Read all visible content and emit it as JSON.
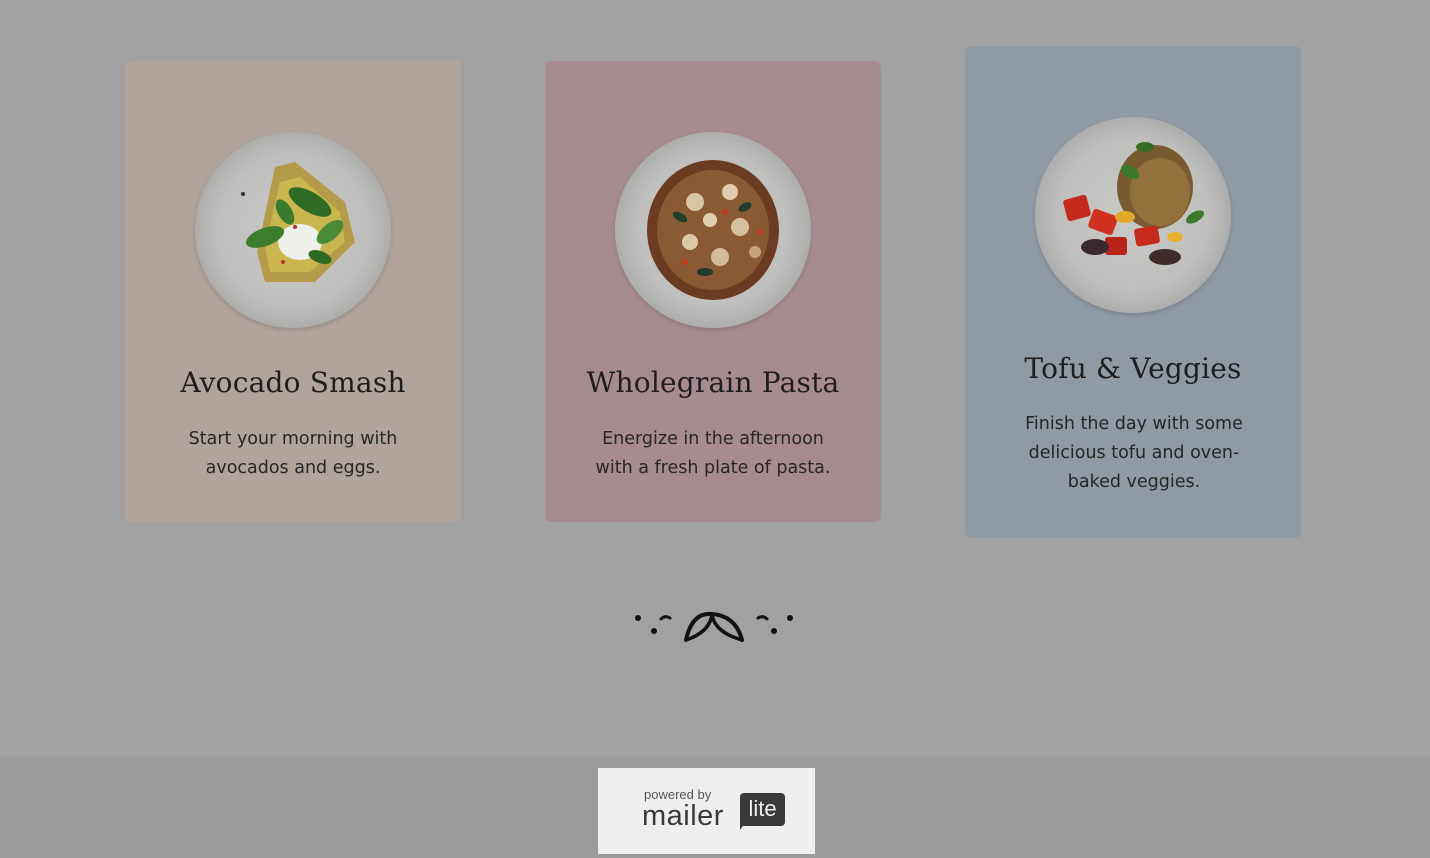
{
  "cards": [
    {
      "title": "Avocado Smash",
      "description": "Start your morning with avocados and eggs.",
      "image": "avocado-toast-plate"
    },
    {
      "title": "Wholegrain Pasta",
      "description": "Energize in the afternoon with a fresh plate of pasta.",
      "image": "wholegrain-pasta-plate"
    },
    {
      "title": "Tofu & Veggies",
      "description": "Finish the day with some delicious tofu and oven-baked veggies.",
      "image": "tofu-veggies-plate"
    }
  ],
  "divider": {
    "icon": "leaf-dots-divider-icon"
  },
  "footer": {
    "powered_by": "powered by",
    "brand_main": "mailer",
    "brand_badge": "lite"
  },
  "colors": {
    "background": "#a1a1a1",
    "card_1": "#b0a49c",
    "card_2": "#a68c91",
    "card_3": "#8f9aa5"
  }
}
